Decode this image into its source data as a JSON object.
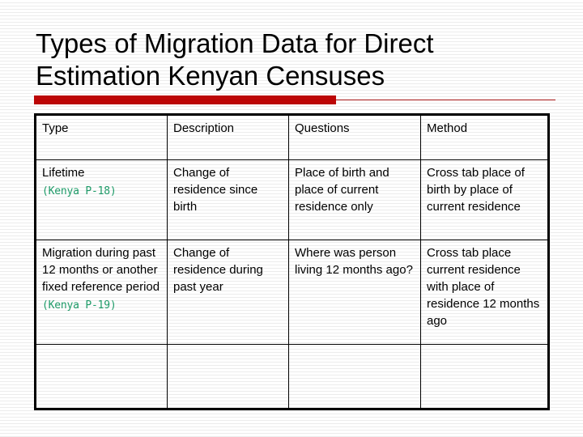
{
  "slide": {
    "title": "Types of Migration Data for Direct\nEstimation Kenyan Censuses",
    "accent_color": "#c00606",
    "accent_line_color": "#b01414",
    "source_note_color": "#1e9e6a",
    "text_color": "#000000",
    "background_color": "#ffffff"
  },
  "table": {
    "columns": [
      {
        "key": "type",
        "header": "Type"
      },
      {
        "key": "description",
        "header": "Description"
      },
      {
        "key": "questions",
        "header": "Questions"
      },
      {
        "key": "method",
        "header": "Method"
      }
    ],
    "rows": [
      {
        "type": "Lifetime",
        "type_note": "(Kenya P-18)",
        "description": "Change of residence since birth",
        "questions": "Place of birth and place of current residence only",
        "method": "Cross tab place of birth by place of current residence"
      },
      {
        "type": "Migration during past 12 months or another fixed reference period",
        "type_note": "(Kenya P-19)",
        "description": "Change of residence during past year",
        "questions": "Where was person living 12 months ago?",
        "method": "Cross tab place current residence with place of residence 12 months ago"
      },
      {
        "type": "",
        "type_note": "",
        "description": "",
        "questions": "",
        "method": ""
      }
    ]
  }
}
